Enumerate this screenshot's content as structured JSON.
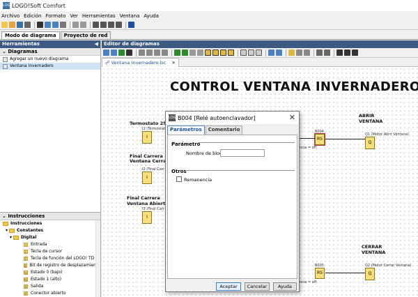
{
  "app": {
    "title": "LOGO!Soft Comfort",
    "logo_text": "LOGO"
  },
  "menu": [
    "Archivo",
    "Edición",
    "Formato",
    "Ver",
    "Herramientas",
    "Ventana",
    "Ayuda"
  ],
  "mode_tabs": [
    "Modo de diagrama",
    "Proyecto de red"
  ],
  "left_panel": {
    "header": "Herramientas",
    "diagrams_label": "Diagramas",
    "diagram_items": [
      "Agregar un nuevo diagrama",
      "Ventana Invernadero"
    ],
    "instructions_label": "Instrucciones",
    "instructions_tree": {
      "root": "Instrucciones",
      "constants": "Constantes",
      "digital": "Digital",
      "items": [
        {
          "code": "I",
          "label": "Entrada"
        },
        {
          "code": "C",
          "label": "Tecla de cursor"
        },
        {
          "code": "F",
          "label": "Tecla de función del LOGO! TD"
        },
        {
          "code": "S",
          "label": "Bit de registro de desplazamiento"
        },
        {
          "code": "lo",
          "label": "Estado 0 (bajo)"
        },
        {
          "code": "hi",
          "label": "Estado 1 (alto)"
        },
        {
          "code": "Q",
          "label": "Salida"
        },
        {
          "code": "X",
          "label": "Conector abierto"
        }
      ]
    }
  },
  "editor": {
    "header": "Editor de diagramas",
    "doc_tab": "Ventana Invernadero.lsc",
    "diagram_title": "CONTROL VENTANA INVERNADERO",
    "labels": {
      "termostato": "Termostato 25 C",
      "termostato_sub": "I1 (Termostato",
      "fc_cerrada_1": "Final Carrera",
      "fc_cerrada_2": "Ventana Cerrada",
      "fc_cerrada_sub": "I2 (Final Carr",
      "fc_abierta_1": "Final Carrera",
      "fc_abierta_2": "Ventana Abierta",
      "fc_abierta_sub": "I3 (Final Carr",
      "abrir_1": "ABRIR",
      "abrir_2": "VENTANA",
      "abrir_out": "Q1 (Motor Abrir Ventana)",
      "cerrar_1": "CERRAR",
      "cerrar_2": "VENTANA",
      "cerrar_out": "Q2 (Motor Cerrar Ventana)",
      "b004": "B004",
      "b005": "B005",
      "rs": "RS",
      "q": "Q",
      "i": "I",
      "remanent": "ncia = off"
    }
  },
  "dialog": {
    "title": "B004 [Relé autoenclavador]",
    "tabs": [
      "Parámetros",
      "Comentario"
    ],
    "section_param": "Parámetro",
    "block_name_label": "Nombre de bloque:",
    "block_name_value": "",
    "section_otros": "Otros",
    "remanencia_label": "Remanencia",
    "buttons": {
      "accept": "Aceptar",
      "cancel": "Cancelar",
      "help": "Ayuda"
    }
  }
}
